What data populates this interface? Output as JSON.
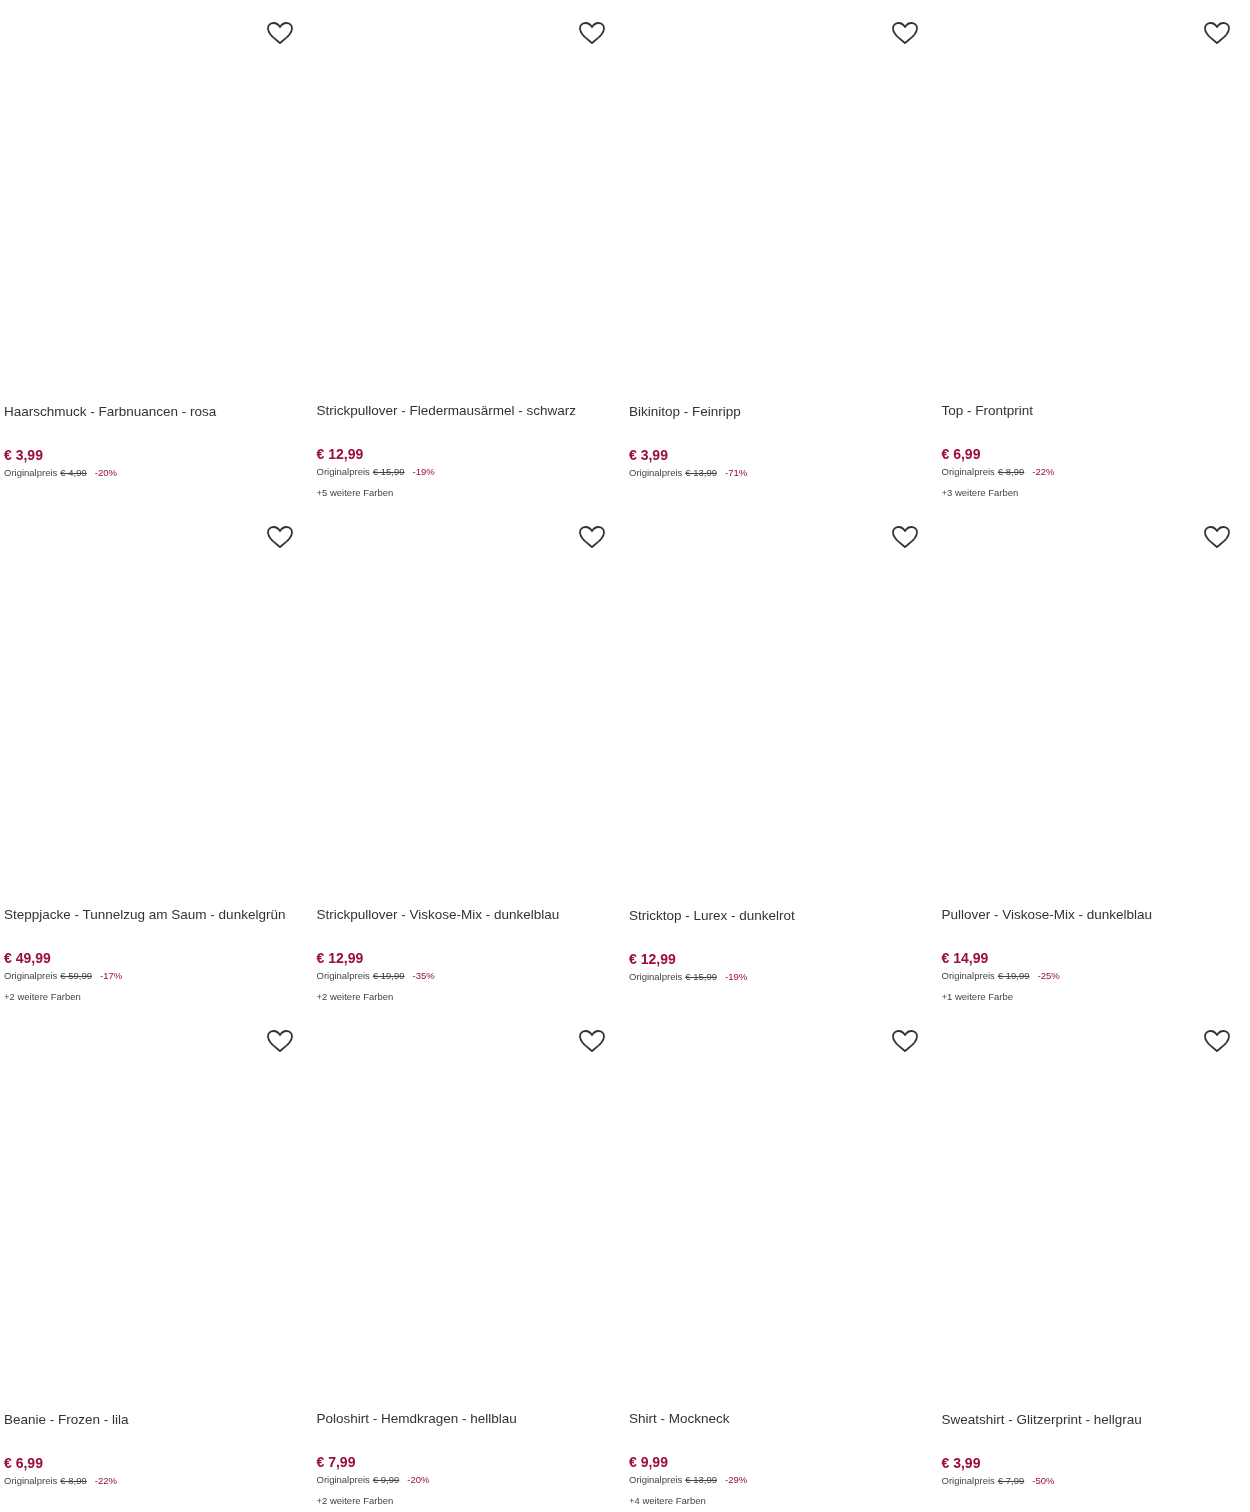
{
  "products": [
    {
      "title": "Haarschmuck - Farbnuancen - rosa",
      "price": "€ 3,99",
      "original_label": "Originalpreis",
      "original_price": "€ 4,99",
      "discount": "-20%",
      "favorite": false
    },
    {
      "title": "Strickpullover - Fledermausärmel - schwarz",
      "price": "€ 12,99",
      "original_label": "Originalpreis",
      "original_price": "€ 15,99",
      "discount": "-19%",
      "more_colors": "+5 weitere Farben",
      "favorite": false
    },
    {
      "title": "Bikinitop - Feinripp",
      "price": "€ 3,99",
      "original_label": "Originalpreis",
      "original_price": "€ 13,99",
      "discount": "-71%",
      "favorite": false
    },
    {
      "title": "Top - Frontprint",
      "price": "€ 6,99",
      "original_label": "Originalpreis",
      "original_price": "€ 8,99",
      "discount": "-22%",
      "more_colors": "+3 weitere Farben",
      "favorite": false
    },
    {
      "title": "Steppjacke - Tunnelzug am Saum - dunkelgrün",
      "price": "€ 49,99",
      "original_label": "Originalpreis",
      "original_price": "€ 59,99",
      "discount": "-17%",
      "more_colors": "+2 weitere Farben",
      "favorite": false
    },
    {
      "title": "Strickpullover - Viskose-Mix - dunkelblau",
      "price": "€ 12,99",
      "original_label": "Originalpreis",
      "original_price": "€ 19,99",
      "discount": "-35%",
      "more_colors": "+2 weitere Farben",
      "favorite": false
    },
    {
      "title": "Stricktop - Lurex - dunkelrot",
      "price": "€ 12,99",
      "original_label": "Originalpreis",
      "original_price": "€ 15,99",
      "discount": "-19%",
      "favorite": false
    },
    {
      "title": "Pullover - Viskose-Mix - dunkelblau",
      "price": "€ 14,99",
      "original_label": "Originalpreis",
      "original_price": "€ 19,99",
      "discount": "-25%",
      "more_colors": "+1 weitere Farbe",
      "favorite": false
    },
    {
      "title": "Beanie - Frozen - lila",
      "price": "€ 6,99",
      "original_label": "Originalpreis",
      "original_price": "€ 8,99",
      "discount": "-22%",
      "favorite": false
    },
    {
      "title": "Poloshirt - Hemdkragen - hellblau",
      "price": "€ 7,99",
      "original_label": "Originalpreis",
      "original_price": "€ 9,99",
      "discount": "-20%",
      "more_colors": "+2 weitere Farben",
      "favorite": false
    },
    {
      "title": "Shirt - Mockneck",
      "price": "€ 9,99",
      "original_label": "Originalpreis",
      "original_price": "€ 13,99",
      "discount": "-29%",
      "more_colors": "+4 weitere Farben",
      "favorite": false
    },
    {
      "title": "Sweatshirt - Glitzerprint - hellgrau",
      "price": "€ 3,99",
      "original_label": "Originalpreis",
      "original_price": "€ 7,99",
      "discount": "-50%",
      "favorite": false
    }
  ]
}
